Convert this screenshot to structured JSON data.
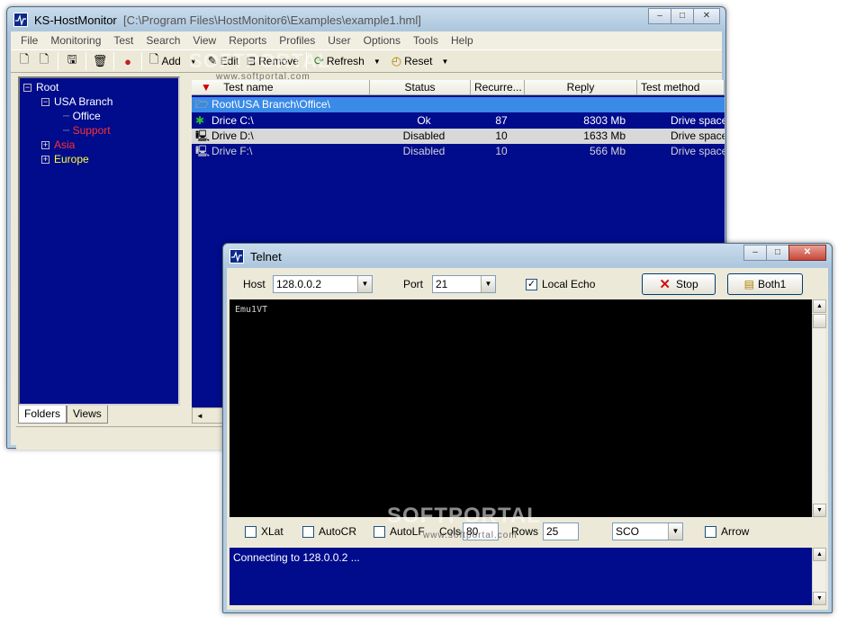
{
  "main": {
    "title": "KS-HostMonitor",
    "title_path": "[C:\\Program Files\\HostMonitor6\\Examples\\example1.hml]",
    "win_buttons": [
      "–",
      "□",
      "✕"
    ],
    "menu": [
      "File",
      "Monitoring",
      "Test",
      "Search",
      "View",
      "Reports",
      "Profiles",
      "User",
      "Options",
      "Tools",
      "Help"
    ],
    "toolbar": {
      "add": "Add",
      "edit": "Edit",
      "remove": "Remove",
      "refresh": "Refresh",
      "reset": "Reset"
    },
    "tree": [
      {
        "label": "Root",
        "color": "#ffffff",
        "expander": "−"
      },
      {
        "label": "USA Branch",
        "color": "#ffffff",
        "expander": "−"
      },
      {
        "label": "Office",
        "color": "#ffffff"
      },
      {
        "label": "Support",
        "color": "#ff3030"
      },
      {
        "label": "Asia",
        "color": "#ff3030",
        "expander": "+"
      },
      {
        "label": "Europe",
        "color": "#ffff30",
        "expander": "+"
      }
    ],
    "tabs": [
      "Folders",
      "Views"
    ],
    "columns": [
      "Test name",
      "Status",
      "Recurre...",
      "Reply",
      "Test method"
    ],
    "folder_row": "Root\\USA Branch\\Office\\",
    "rows": [
      {
        "name": "Drice C:\\",
        "status": "Ok",
        "recur": "87",
        "reply": "8303 Mb",
        "method": "Drive space"
      },
      {
        "name": "Drive D:\\",
        "status": "Disabled",
        "recur": "10",
        "reply": "1633 Mb",
        "method": "Drive space"
      },
      {
        "name": "Drive F:\\",
        "status": "Disabled",
        "recur": "10",
        "reply": "566 Mb",
        "method": "Drive space"
      }
    ]
  },
  "telnet": {
    "title": "Telnet",
    "host_label": "Host",
    "host_value": "128.0.0.2",
    "port_label": "Port",
    "port_value": "21",
    "local_echo_label": "Local Echo",
    "local_echo_checked": true,
    "stop_label": "Stop",
    "both_label": "Both1",
    "terminal_text": "Emu1VT",
    "xlat_label": "XLat",
    "autocr_label": "AutoCR",
    "autolf_label": "AutoLF",
    "cols_label": "Cols",
    "cols_value": "80",
    "rows_label": "Rows",
    "rows_value": "25",
    "emulation_value": "SCO",
    "arrow_label": "Arrow",
    "log_text": "Connecting to 128.0.0.2 ..."
  },
  "watermark": {
    "brand": "SOFTPORTAL",
    "url": "www.softportal.com"
  }
}
